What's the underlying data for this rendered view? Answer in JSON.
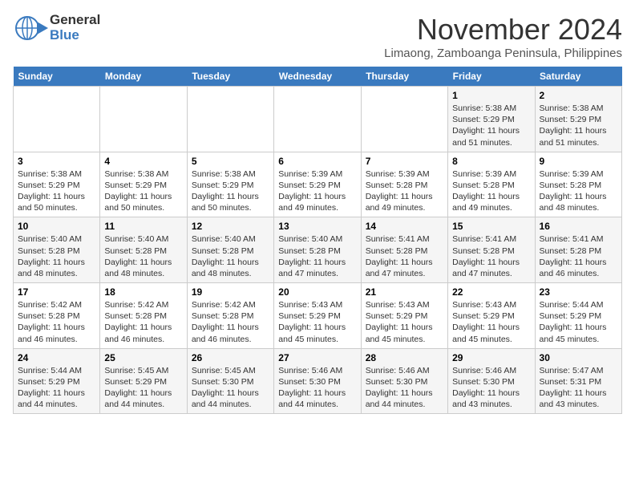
{
  "header": {
    "logo_line1": "General",
    "logo_line2": "Blue",
    "month": "November 2024",
    "location": "Limaong, Zamboanga Peninsula, Philippines"
  },
  "days_of_week": [
    "Sunday",
    "Monday",
    "Tuesday",
    "Wednesday",
    "Thursday",
    "Friday",
    "Saturday"
  ],
  "weeks": [
    [
      {
        "day": "",
        "info": ""
      },
      {
        "day": "",
        "info": ""
      },
      {
        "day": "",
        "info": ""
      },
      {
        "day": "",
        "info": ""
      },
      {
        "day": "",
        "info": ""
      },
      {
        "day": "1",
        "info": "Sunrise: 5:38 AM\nSunset: 5:29 PM\nDaylight: 11 hours and 51 minutes."
      },
      {
        "day": "2",
        "info": "Sunrise: 5:38 AM\nSunset: 5:29 PM\nDaylight: 11 hours and 51 minutes."
      }
    ],
    [
      {
        "day": "3",
        "info": "Sunrise: 5:38 AM\nSunset: 5:29 PM\nDaylight: 11 hours and 50 minutes."
      },
      {
        "day": "4",
        "info": "Sunrise: 5:38 AM\nSunset: 5:29 PM\nDaylight: 11 hours and 50 minutes."
      },
      {
        "day": "5",
        "info": "Sunrise: 5:38 AM\nSunset: 5:29 PM\nDaylight: 11 hours and 50 minutes."
      },
      {
        "day": "6",
        "info": "Sunrise: 5:39 AM\nSunset: 5:29 PM\nDaylight: 11 hours and 49 minutes."
      },
      {
        "day": "7",
        "info": "Sunrise: 5:39 AM\nSunset: 5:28 PM\nDaylight: 11 hours and 49 minutes."
      },
      {
        "day": "8",
        "info": "Sunrise: 5:39 AM\nSunset: 5:28 PM\nDaylight: 11 hours and 49 minutes."
      },
      {
        "day": "9",
        "info": "Sunrise: 5:39 AM\nSunset: 5:28 PM\nDaylight: 11 hours and 48 minutes."
      }
    ],
    [
      {
        "day": "10",
        "info": "Sunrise: 5:40 AM\nSunset: 5:28 PM\nDaylight: 11 hours and 48 minutes."
      },
      {
        "day": "11",
        "info": "Sunrise: 5:40 AM\nSunset: 5:28 PM\nDaylight: 11 hours and 48 minutes."
      },
      {
        "day": "12",
        "info": "Sunrise: 5:40 AM\nSunset: 5:28 PM\nDaylight: 11 hours and 48 minutes."
      },
      {
        "day": "13",
        "info": "Sunrise: 5:40 AM\nSunset: 5:28 PM\nDaylight: 11 hours and 47 minutes."
      },
      {
        "day": "14",
        "info": "Sunrise: 5:41 AM\nSunset: 5:28 PM\nDaylight: 11 hours and 47 minutes."
      },
      {
        "day": "15",
        "info": "Sunrise: 5:41 AM\nSunset: 5:28 PM\nDaylight: 11 hours and 47 minutes."
      },
      {
        "day": "16",
        "info": "Sunrise: 5:41 AM\nSunset: 5:28 PM\nDaylight: 11 hours and 46 minutes."
      }
    ],
    [
      {
        "day": "17",
        "info": "Sunrise: 5:42 AM\nSunset: 5:28 PM\nDaylight: 11 hours and 46 minutes."
      },
      {
        "day": "18",
        "info": "Sunrise: 5:42 AM\nSunset: 5:28 PM\nDaylight: 11 hours and 46 minutes."
      },
      {
        "day": "19",
        "info": "Sunrise: 5:42 AM\nSunset: 5:28 PM\nDaylight: 11 hours and 46 minutes."
      },
      {
        "day": "20",
        "info": "Sunrise: 5:43 AM\nSunset: 5:29 PM\nDaylight: 11 hours and 45 minutes."
      },
      {
        "day": "21",
        "info": "Sunrise: 5:43 AM\nSunset: 5:29 PM\nDaylight: 11 hours and 45 minutes."
      },
      {
        "day": "22",
        "info": "Sunrise: 5:43 AM\nSunset: 5:29 PM\nDaylight: 11 hours and 45 minutes."
      },
      {
        "day": "23",
        "info": "Sunrise: 5:44 AM\nSunset: 5:29 PM\nDaylight: 11 hours and 45 minutes."
      }
    ],
    [
      {
        "day": "24",
        "info": "Sunrise: 5:44 AM\nSunset: 5:29 PM\nDaylight: 11 hours and 44 minutes."
      },
      {
        "day": "25",
        "info": "Sunrise: 5:45 AM\nSunset: 5:29 PM\nDaylight: 11 hours and 44 minutes."
      },
      {
        "day": "26",
        "info": "Sunrise: 5:45 AM\nSunset: 5:30 PM\nDaylight: 11 hours and 44 minutes."
      },
      {
        "day": "27",
        "info": "Sunrise: 5:46 AM\nSunset: 5:30 PM\nDaylight: 11 hours and 44 minutes."
      },
      {
        "day": "28",
        "info": "Sunrise: 5:46 AM\nSunset: 5:30 PM\nDaylight: 11 hours and 44 minutes."
      },
      {
        "day": "29",
        "info": "Sunrise: 5:46 AM\nSunset: 5:30 PM\nDaylight: 11 hours and 43 minutes."
      },
      {
        "day": "30",
        "info": "Sunrise: 5:47 AM\nSunset: 5:31 PM\nDaylight: 11 hours and 43 minutes."
      }
    ]
  ]
}
